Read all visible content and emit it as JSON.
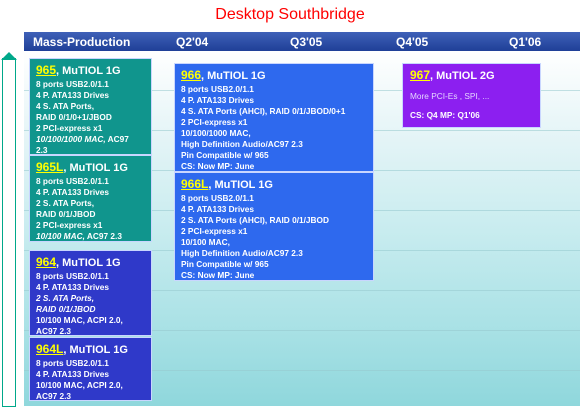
{
  "title": "Desktop Southbridge",
  "columns": [
    "Mass-Production",
    "Q2'04",
    "Q3'05",
    "Q4'05",
    "Q1'06"
  ],
  "products": [
    {
      "chip": "965",
      "name": ", MuTIOL 1G",
      "lines": [
        "8 ports USB2.0/1.1",
        "4 P. ATA133 Drives",
        "4 S. ATA Ports,",
        "RAID 0/1/0+1/JBOD",
        "2 PCI-express x1"
      ],
      "line_italic": "10/100/1000  MAC,",
      "line_italic_tail": " AC97",
      "line_last": "2.3"
    },
    {
      "chip": "965L",
      "name": ", MuTIOL 1G",
      "lines": [
        "8 ports USB2.0/1.1",
        "4 P. ATA133 Drives",
        "2 S. ATA Ports,",
        "RAID 0/1/JBOD",
        "2 PCI-express x1"
      ],
      "line_italic": "10/100  MAC,",
      "line_italic_tail": " AC97 2.3"
    },
    {
      "chip": "964",
      "name": ", MuTIOL 1G",
      "lines": [
        "8 ports USB2.0/1.1",
        "4 P. ATA133 Drives"
      ],
      "italic_lines": [
        "2 S. ATA Ports,",
        "RAID 0/1/JBOD"
      ],
      "tail_lines": [
        "10/100  MAC, ACPI 2.0,",
        "AC97 2.3"
      ]
    },
    {
      "chip": "964L",
      "name": ", MuTIOL 1G",
      "lines": [
        "8 ports USB2.0/1.1",
        "4 P. ATA133 Drives",
        "10/100 MAC, ACPI 2.0,",
        "AC97 2.3"
      ]
    },
    {
      "chip": "966",
      "name": ", MuTIOL 1G",
      "lines": [
        "8 ports USB2.0/1.1",
        "4 P. ATA133 Drives",
        "4 S. ATA Ports (AHCI), RAID 0/1/JBOD/0+1",
        "2 PCI-express x1",
        "10/100/1000 MAC,",
        "High Definition Audio/AC97 2.3",
        "Pin Compatible w/ 965",
        "CS: Now  MP: June"
      ]
    },
    {
      "chip": "966L",
      "name": ", MuTIOL 1G",
      "lines": [
        "8 ports USB2.0/1.1",
        "4 P. ATA133 Drives",
        "2 S. ATA Ports (AHCI), RAID 0/1/JBOD",
        "2 PCI-express x1",
        "10/100  MAC,",
        "High Definition Audio/AC97 2.3",
        "Pin Compatible w/ 965",
        "CS: Now  MP: June"
      ]
    },
    {
      "chip": "967",
      "name": ", MuTIOL 2G",
      "lines": [
        "More PCI-Es , SPI, ...",
        "CS: Q4  MP: Q1'06"
      ]
    }
  ],
  "colors": {
    "title": "#ff0000",
    "header": "#2a4aa8",
    "teal": "#10958d",
    "indigo": "#2f39c9",
    "blue": "#2e69ee",
    "purple": "#8c1ff0",
    "chip": "#ffff00"
  }
}
